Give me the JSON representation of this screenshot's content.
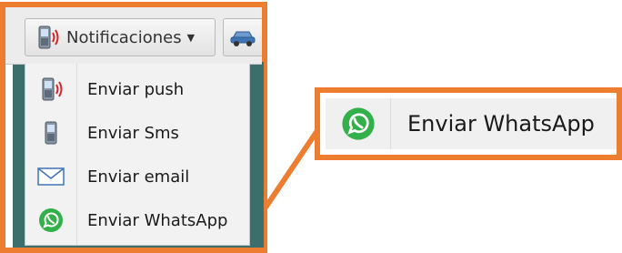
{
  "toolbar": {
    "notifications_label": "Notificaciones",
    "notifications_icon": "phone-signal-icon",
    "dropdown_icon": "caret-down-icon",
    "next_button_icon": "car-icon"
  },
  "menu": {
    "items": [
      {
        "label": "Enviar push",
        "icon": "phone-signal-icon"
      },
      {
        "label": "Enviar Sms",
        "icon": "mobile-phone-icon"
      },
      {
        "label": "Enviar email",
        "icon": "envelope-icon"
      },
      {
        "label": "Enviar WhatsApp",
        "icon": "whatsapp-icon"
      }
    ]
  },
  "callout": {
    "label": "Enviar WhatsApp",
    "icon": "whatsapp-icon"
  },
  "colors": {
    "highlight": "#ed7d31",
    "whatsapp": "#34b04a",
    "backdrop": "#3b6f6c"
  }
}
